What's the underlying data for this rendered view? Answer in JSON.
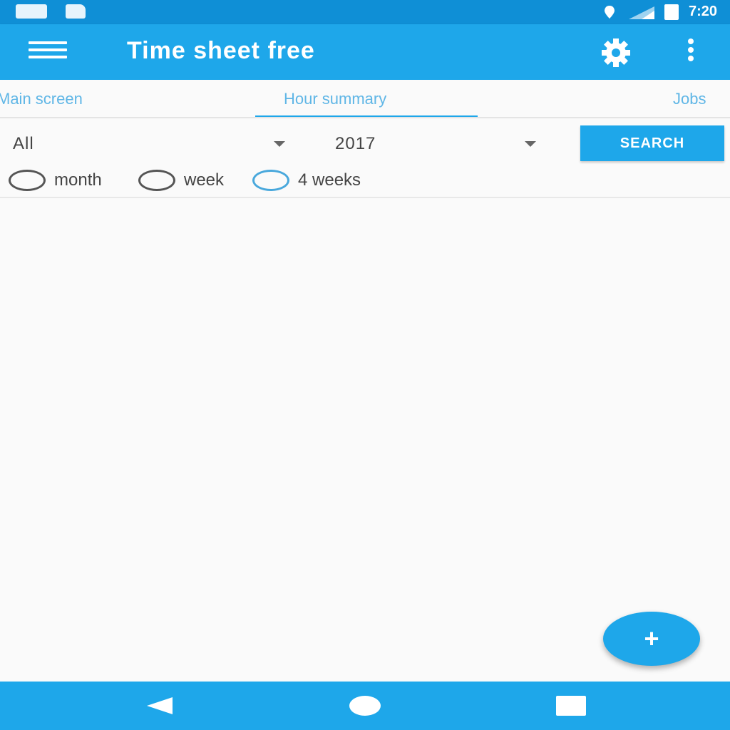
{
  "status_bar": {
    "time": "7:20",
    "icons": [
      "message-icon",
      "file-icon",
      "location-icon",
      "signal-icon",
      "battery-icon"
    ]
  },
  "app_bar": {
    "title": "Time sheet free",
    "icons": [
      "menu-icon",
      "settings-icon",
      "overflow-menu-icon"
    ]
  },
  "tabs": [
    {
      "label": "Main screen",
      "selected": false
    },
    {
      "label": "Hour summary",
      "selected": true
    },
    {
      "label": "Jobs",
      "selected": false
    }
  ],
  "filters": {
    "category": {
      "value": "All"
    },
    "year": {
      "value": "2017"
    },
    "search_label": "SEARCH",
    "period_options": [
      {
        "label": "month",
        "selected": false
      },
      {
        "label": "week",
        "selected": false
      },
      {
        "label": "4 weeks",
        "selected": true
      }
    ]
  },
  "fab": {
    "label": "+"
  },
  "nav_bar": {
    "icons": [
      "back-icon",
      "home-icon",
      "recent-apps-icon"
    ]
  },
  "colors": {
    "status_bar": "#0f8fd6",
    "primary": "#1ea7ea",
    "tab_text": "#5fb6e6",
    "background": "#fafafa"
  }
}
